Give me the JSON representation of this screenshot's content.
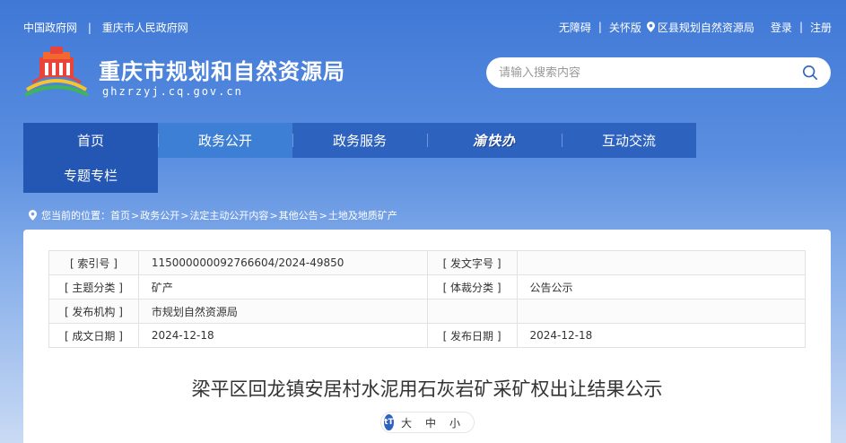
{
  "topbar": {
    "left": [
      "中国政府网",
      "重庆市人民政府网"
    ],
    "separator": "|",
    "accessibility": "无障碍",
    "elderly": "关怀版",
    "district": "区县规划自然资源局",
    "login": "登录",
    "register": "注册"
  },
  "header": {
    "title": "重庆市规划和自然资源局",
    "domain": "ghzrzyj.cq.gov.cn"
  },
  "search": {
    "placeholder": "请输入搜索内容"
  },
  "nav": {
    "items": [
      "首页",
      "政务公开",
      "政务服务",
      "渝快办",
      "互动交流",
      "专题专栏"
    ],
    "active_index": 1
  },
  "breadcrumb": {
    "prefix": "您当前的位置：",
    "items": [
      "首页",
      "政务公开",
      "法定主动公开内容",
      "其他公告",
      "土地及地质矿产"
    ],
    "separator": ">"
  },
  "meta": {
    "rows": [
      [
        "[ 索引号 ]",
        "115000000092766604/2024-49850",
        "[ 发文字号 ]",
        ""
      ],
      [
        "[ 主题分类 ]",
        "矿产",
        "[ 体裁分类 ]",
        "公告公示"
      ],
      [
        "[ 发布机构 ]",
        "市规划自然资源局",
        "",
        ""
      ],
      [
        "[ 成文日期 ]",
        "2024-12-18",
        "[ 发布日期 ]",
        "2024-12-18"
      ]
    ]
  },
  "article": {
    "title": "梁平区回龙镇安居村水泥用石灰岩矿采矿权出让结果公示"
  },
  "font_size": {
    "icon": "tT",
    "large": "大",
    "medium": "中",
    "small": "小"
  },
  "colors": {
    "nav_bg": "#2d62bf",
    "nav_active": "#3e7fd6",
    "accent": "#2457b4"
  }
}
